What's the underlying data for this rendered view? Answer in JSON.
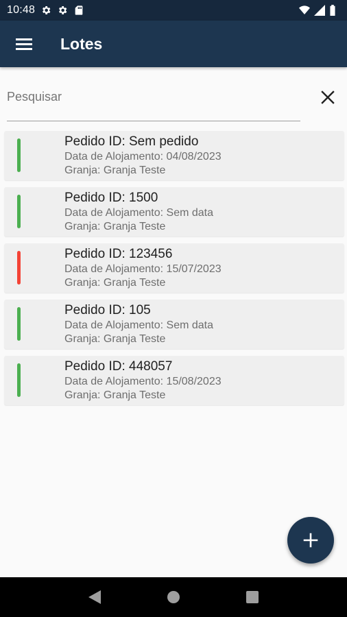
{
  "status_bar": {
    "time": "10:48",
    "left_icons": [
      "gear-icon",
      "gear-icon",
      "sd-card-icon"
    ],
    "right_icons": [
      "wifi-icon",
      "signal-icon",
      "battery-icon"
    ]
  },
  "app_bar": {
    "title": "Lotes",
    "menu_icon": "menu-icon",
    "background": "#1d3650"
  },
  "search": {
    "placeholder": "Pesquisar",
    "value": "",
    "clear_icon": "close-icon"
  },
  "lotes": [
    {
      "title": "Pedido ID: Sem pedido",
      "date": "Data de Alojamento: 04/08/2023",
      "farm": "Granja: Granja Teste",
      "status_color": "#4caf50"
    },
    {
      "title": "Pedido ID: 1500",
      "date": "Data de Alojamento: Sem data",
      "farm": "Granja: Granja Teste",
      "status_color": "#4caf50"
    },
    {
      "title": "Pedido ID: 123456",
      "date": "Data de Alojamento: 15/07/2023",
      "farm": "Granja: Granja Teste",
      "status_color": "#f44336"
    },
    {
      "title": "Pedido ID: 105",
      "date": "Data de Alojamento: Sem data",
      "farm": "Granja: Granja Teste",
      "status_color": "#4caf50"
    },
    {
      "title": "Pedido ID: 448057",
      "date": "Data de Alojamento: 15/08/2023",
      "farm": "Granja: Granja Teste",
      "status_color": "#4caf50"
    }
  ],
  "fab": {
    "icon": "plus-icon",
    "background": "#1d3650"
  },
  "nav_bar": {
    "icons": [
      "back-icon",
      "home-icon",
      "recents-icon"
    ]
  }
}
